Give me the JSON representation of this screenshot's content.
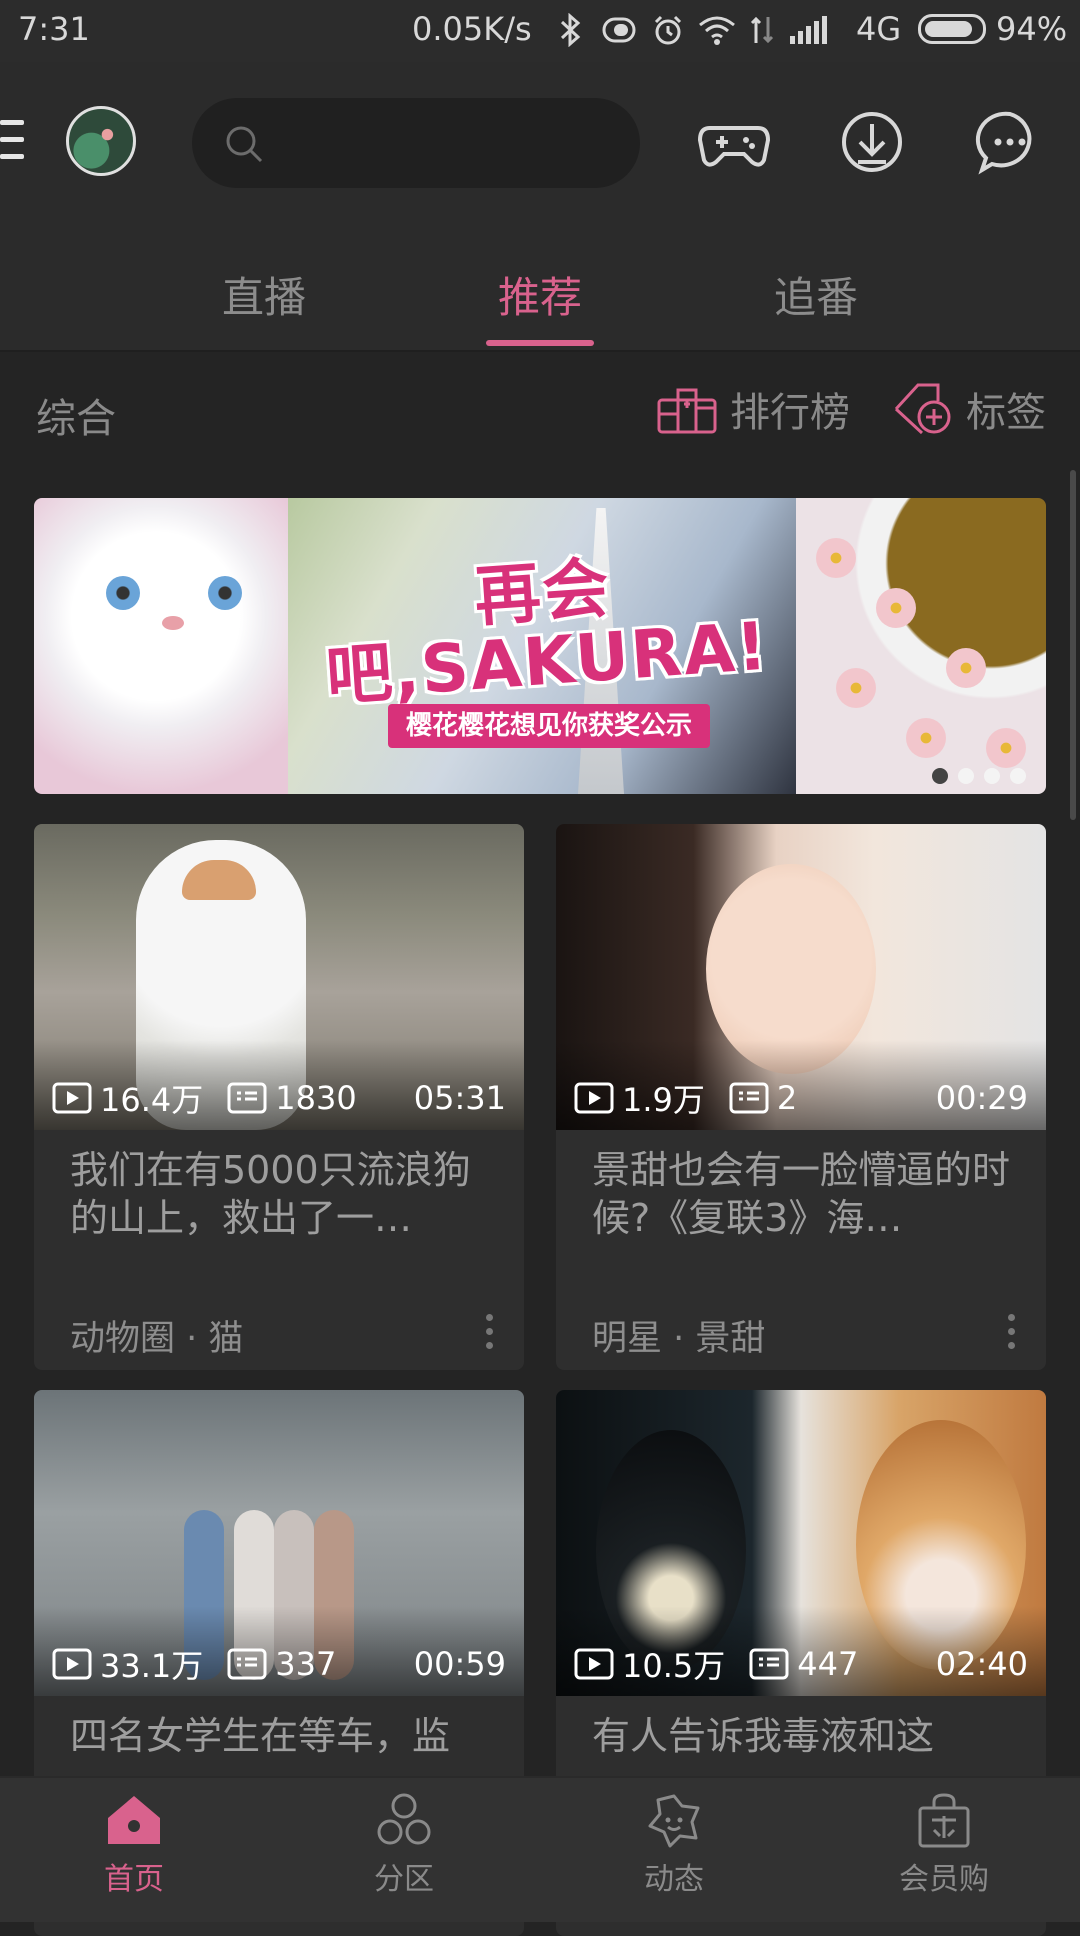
{
  "status_bar": {
    "time": "7:31",
    "speed": "0.05K/s",
    "network": "4G",
    "battery": "94%",
    "battery_level": 0.94
  },
  "header": {
    "search_placeholder": ""
  },
  "tabs": [
    {
      "label": "直播",
      "active": false
    },
    {
      "label": "推荐",
      "active": true
    },
    {
      "label": "追番",
      "active": false
    }
  ],
  "category": {
    "label": "综合",
    "ranking_label": "排行榜",
    "tags_label": "标签"
  },
  "banner": {
    "title": "再会吧,SAKURA!",
    "subtitle": "樱花樱花想见你获奖公示",
    "slide_count": 4,
    "active_slide": 1
  },
  "videos": [
    {
      "plays": "16.4万",
      "danmaku": "1830",
      "duration": "05:31",
      "title": "我们在有5000只流浪狗的山上，救出了一…",
      "tag": "动物圈 · 猫"
    },
    {
      "plays": "1.9万",
      "danmaku": "2",
      "duration": "00:29",
      "title": "景甜也会有一脸懵逼的时候?《复联3》海…",
      "tag": "明星 · 景甜"
    },
    {
      "plays": "33.1万",
      "danmaku": "337",
      "duration": "00:59",
      "title": "四名女学生在等车，监",
      "tag": ""
    },
    {
      "plays": "10.5万",
      "danmaku": "447",
      "duration": "02:40",
      "title": "有人告诉我毒液和这",
      "tag": ""
    }
  ],
  "bottom_nav": [
    {
      "label": "首页",
      "icon": "home-icon",
      "active": true
    },
    {
      "label": "分区",
      "icon": "category-icon",
      "active": false
    },
    {
      "label": "动态",
      "icon": "moments-icon",
      "active": false
    },
    {
      "label": "会员购",
      "icon": "shopping-bag-icon",
      "active": false
    }
  ],
  "colors": {
    "accent": "#d9628d",
    "background": "#242424",
    "card": "#2e2e2e"
  }
}
